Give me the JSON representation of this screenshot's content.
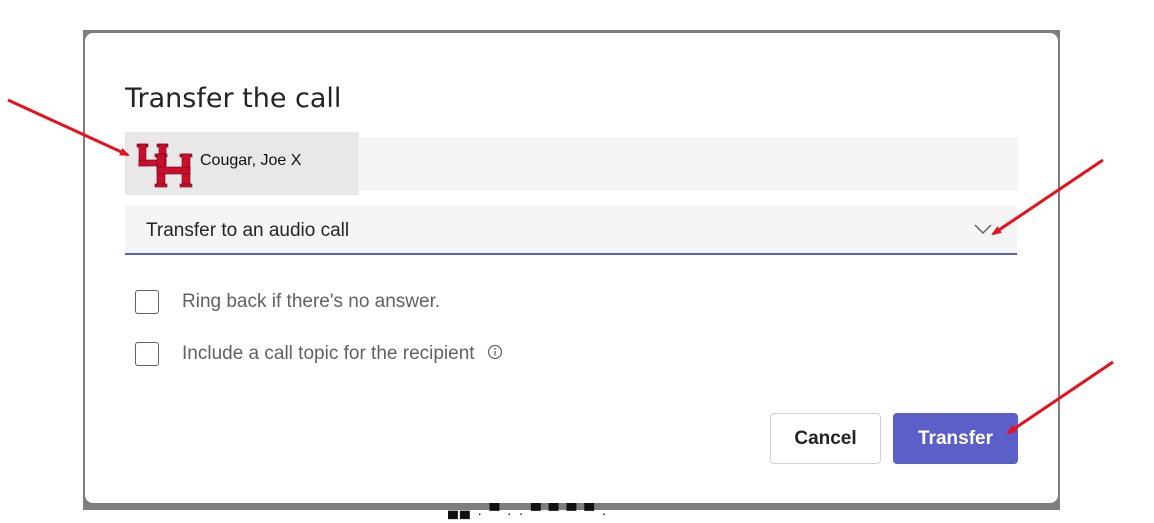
{
  "backdrop": {
    "partial_text": "▄▄ . ▀ . . ▀ ▀ ▀ ▀ ."
  },
  "dialog": {
    "title": "Transfer the call",
    "recipient": {
      "name": "Cougar, Joe X",
      "avatar": "uh-logo"
    },
    "transfer_type": {
      "selected": "Transfer to an audio call",
      "icon": "chevron-down-icon"
    },
    "options": [
      {
        "label": "Ring back if there's no answer.",
        "checked": false
      },
      {
        "label": "Include a call topic for the recipient",
        "checked": false,
        "icon": "info-icon"
      }
    ],
    "buttons": {
      "cancel": "Cancel",
      "transfer": "Transfer"
    }
  },
  "colors": {
    "accent": "#5b5fc7",
    "annotation_arrow": "#e8101a",
    "logo_red": "#c8102e",
    "backdrop": "#7c7f7d"
  }
}
